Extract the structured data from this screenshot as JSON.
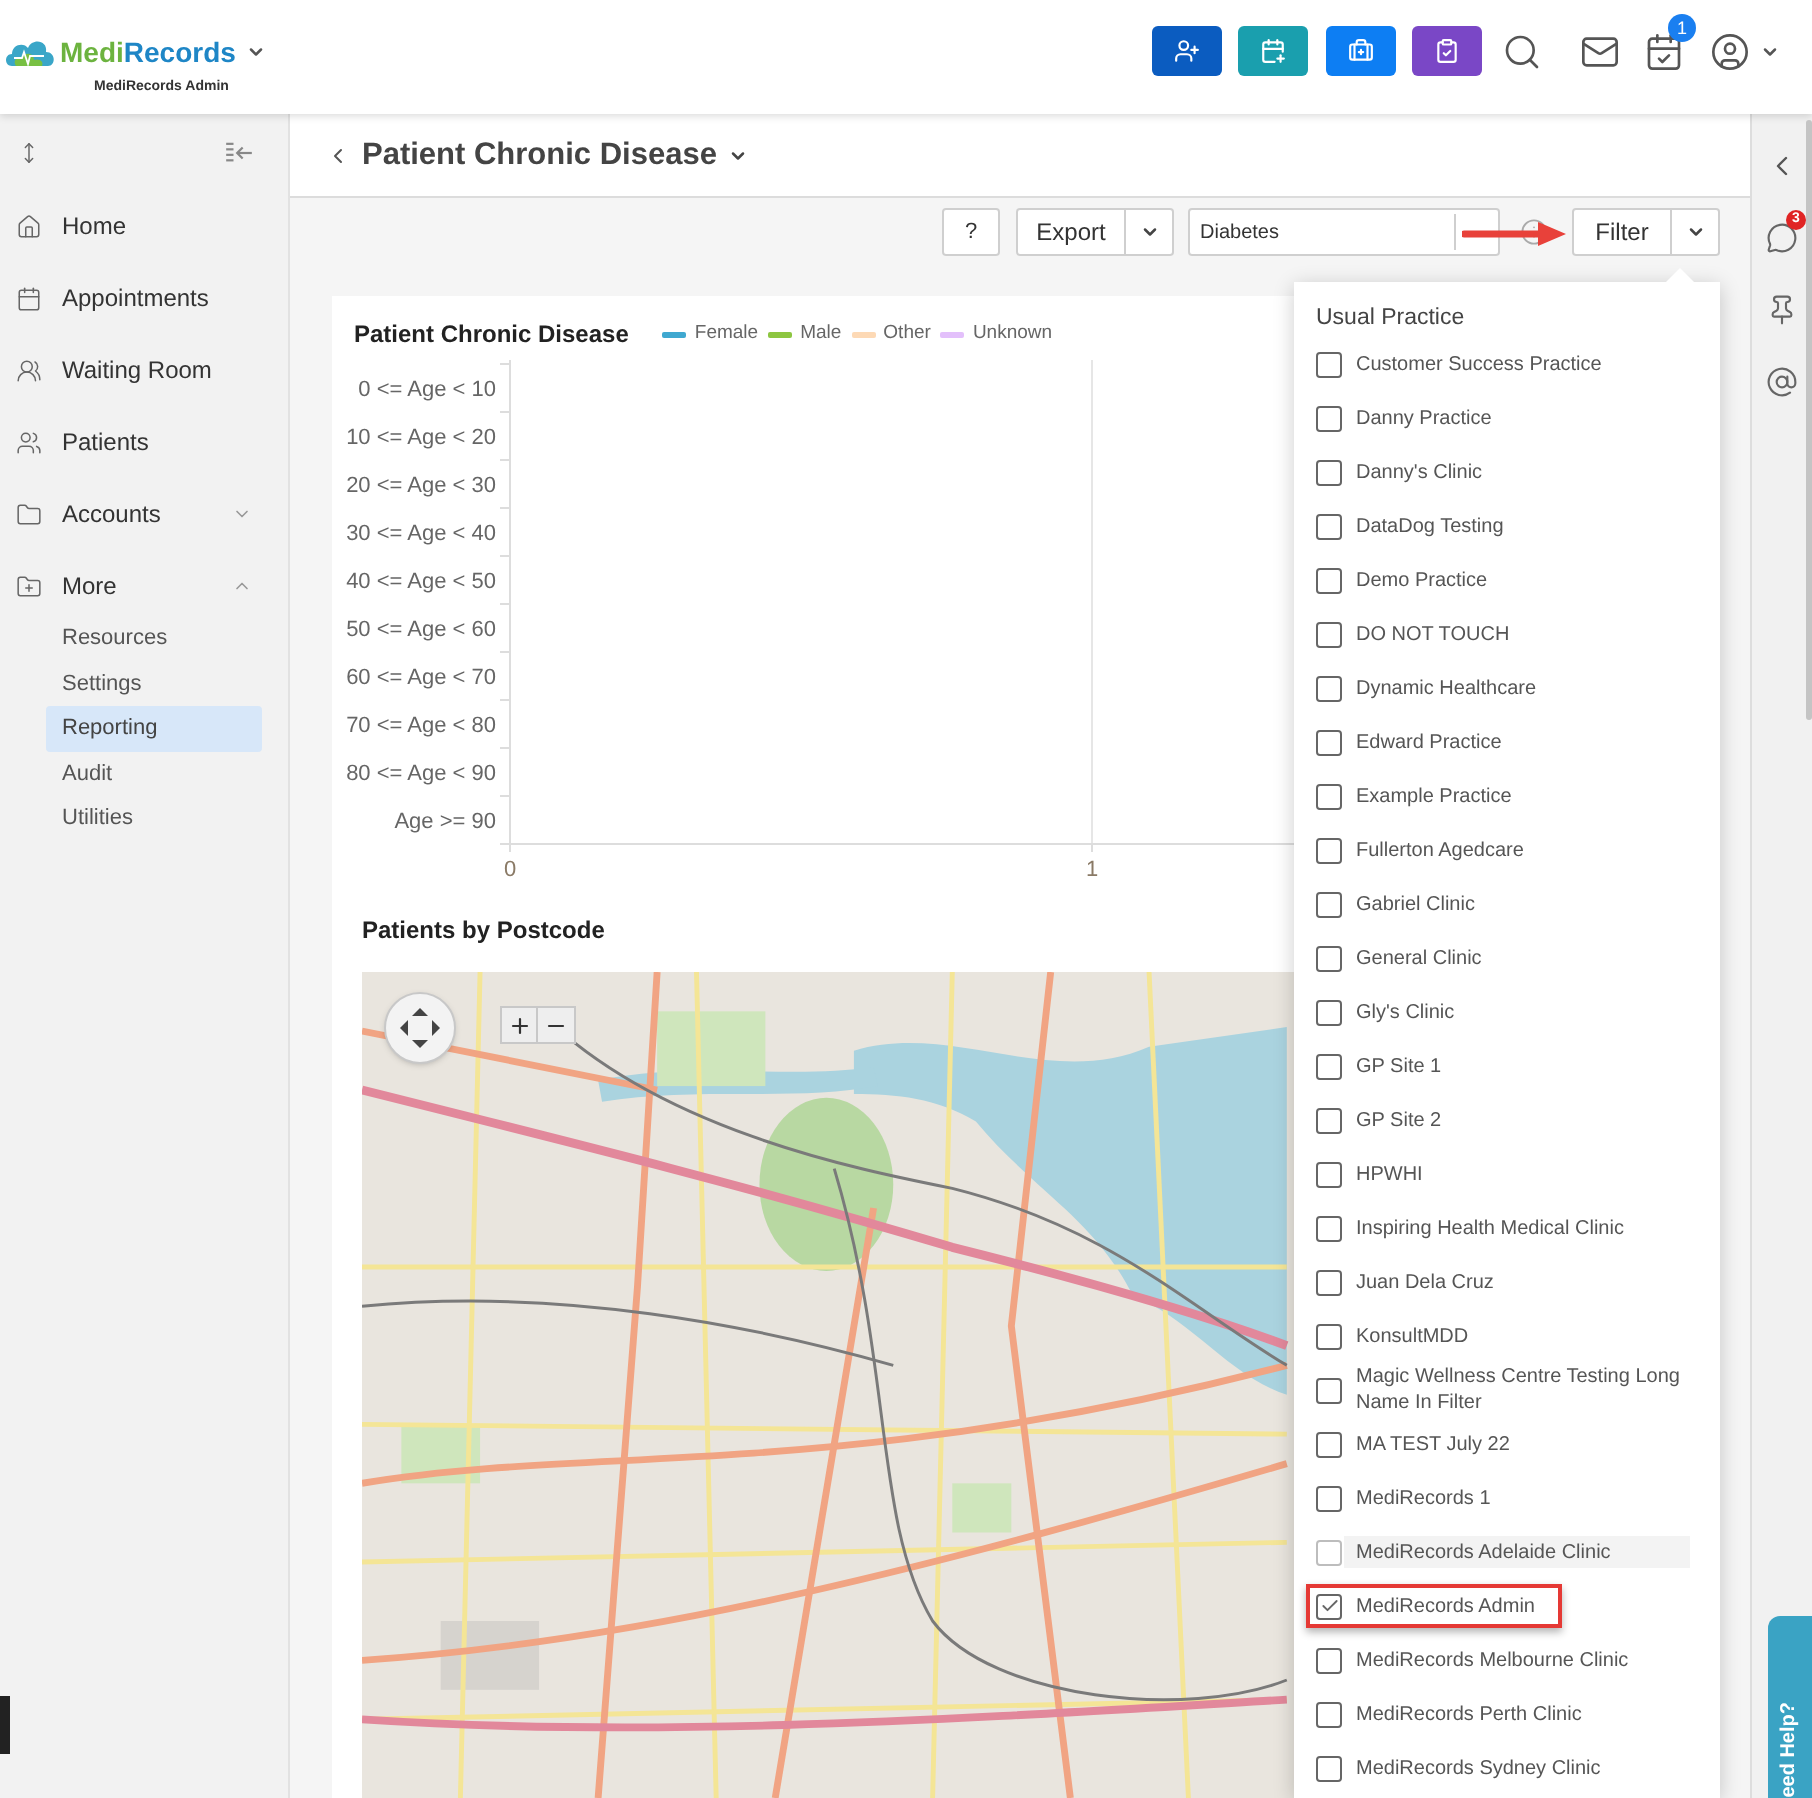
{
  "header": {
    "brand": [
      "Medi",
      "Records"
    ],
    "subtitle": "MediRecords Admin",
    "notification_badge": "1"
  },
  "sidebar": {
    "items": [
      {
        "kind": "link",
        "label": "Home"
      },
      {
        "kind": "link",
        "label": "Appointments"
      },
      {
        "kind": "link",
        "label": "Waiting Room"
      },
      {
        "kind": "link",
        "label": "Patients"
      },
      {
        "kind": "group",
        "label": "Accounts",
        "expanded": false
      },
      {
        "kind": "group",
        "label": "More",
        "expanded": true,
        "children": [
          {
            "label": "Resources",
            "selected": false
          },
          {
            "label": "Settings",
            "selected": false
          },
          {
            "label": "Reporting",
            "selected": true
          },
          {
            "label": "Audit",
            "selected": false
          },
          {
            "label": "Utilities",
            "selected": false
          }
        ]
      }
    ]
  },
  "page": {
    "title": "Patient Chronic Disease"
  },
  "toolbar": {
    "help_button": "?",
    "export_button": "Export",
    "condition_field": {
      "value": "Diabetes"
    },
    "filter_button": "Filter"
  },
  "chart": {
    "chart_data": {
      "type": "bar",
      "orientation": "horizontal",
      "title": "Patient Chronic Disease",
      "categories": [
        "0 <= Age < 10",
        "10 <= Age < 20",
        "20 <= Age < 30",
        "30 <= Age < 40",
        "40 <= Age < 50",
        "50 <= Age < 60",
        "60 <= Age < 70",
        "70 <= Age < 80",
        "80 <= Age < 90",
        "Age >= 90"
      ],
      "series": [
        {
          "name": "Female",
          "color": "#3fa8d0",
          "values": [
            null,
            null,
            null,
            null,
            null,
            null,
            null,
            null,
            null,
            null
          ]
        },
        {
          "name": "Male",
          "color": "#8dc641",
          "values": [
            null,
            null,
            null,
            null,
            null,
            null,
            null,
            null,
            null,
            null
          ]
        },
        {
          "name": "Other",
          "color": "#fdd9b5",
          "values": [
            null,
            null,
            null,
            null,
            null,
            null,
            null,
            null,
            null,
            null
          ]
        },
        {
          "name": "Unknown",
          "color": "#e3c0fb",
          "values": [
            null,
            null,
            null,
            null,
            null,
            null,
            null,
            null,
            null,
            null
          ]
        }
      ],
      "xlim": [
        0,
        2
      ],
      "xticks": [
        0,
        1
      ]
    }
  },
  "map": {
    "title": "Patients by Postcode"
  },
  "filter_menu": {
    "heading": "Usual Practice",
    "options": [
      {
        "label": "Customer Success Practice",
        "checked": false,
        "hovered": false,
        "outlined": false
      },
      {
        "label": "Danny Practice",
        "checked": false,
        "hovered": false,
        "outlined": false
      },
      {
        "label": "Danny's Clinic",
        "checked": false,
        "hovered": false,
        "outlined": false
      },
      {
        "label": "DataDog Testing",
        "checked": false,
        "hovered": false,
        "outlined": false
      },
      {
        "label": "Demo Practice",
        "checked": false,
        "hovered": false,
        "outlined": false
      },
      {
        "label": "DO NOT TOUCH",
        "checked": false,
        "hovered": false,
        "outlined": false
      },
      {
        "label": "Dynamic Healthcare",
        "checked": false,
        "hovered": false,
        "outlined": false
      },
      {
        "label": "Edward Practice",
        "checked": false,
        "hovered": false,
        "outlined": false
      },
      {
        "label": "Example Practice",
        "checked": false,
        "hovered": false,
        "outlined": false
      },
      {
        "label": "Fullerton Agedcare",
        "checked": false,
        "hovered": false,
        "outlined": false
      },
      {
        "label": "Gabriel Clinic",
        "checked": false,
        "hovered": false,
        "outlined": false
      },
      {
        "label": "General Clinic",
        "checked": false,
        "hovered": false,
        "outlined": false
      },
      {
        "label": "Gly's Clinic",
        "checked": false,
        "hovered": false,
        "outlined": false
      },
      {
        "label": "GP Site 1",
        "checked": false,
        "hovered": false,
        "outlined": false
      },
      {
        "label": "GP Site 2",
        "checked": false,
        "hovered": false,
        "outlined": false
      },
      {
        "label": "HPWHI",
        "checked": false,
        "hovered": false,
        "outlined": false
      },
      {
        "label": "Inspiring Health Medical Clinic",
        "checked": false,
        "hovered": false,
        "outlined": false
      },
      {
        "label": "Juan Dela Cruz",
        "checked": false,
        "hovered": false,
        "outlined": false
      },
      {
        "label": "KonsultMDD",
        "checked": false,
        "hovered": false,
        "outlined": false
      },
      {
        "label": "Magic Wellness Centre Testing Long Name In Filter",
        "checked": false,
        "hovered": false,
        "outlined": false
      },
      {
        "label": "MA TEST July 22",
        "checked": false,
        "hovered": false,
        "outlined": false
      },
      {
        "label": "MediRecords 1",
        "checked": false,
        "hovered": false,
        "outlined": false
      },
      {
        "label": "MediRecords Adelaide Clinic",
        "checked": false,
        "hovered": true,
        "outlined": false
      },
      {
        "label": "MediRecords Admin",
        "checked": true,
        "hovered": false,
        "outlined": true
      },
      {
        "label": "MediRecords Melbourne Clinic",
        "checked": false,
        "hovered": false,
        "outlined": false
      },
      {
        "label": "MediRecords Perth Clinic",
        "checked": false,
        "hovered": false,
        "outlined": false
      },
      {
        "label": "MediRecords Sydney Clinic",
        "checked": false,
        "hovered": false,
        "outlined": false
      }
    ]
  },
  "right_rail": {
    "chat_badge": "3"
  },
  "help_tab": {
    "label": "eed Help?"
  }
}
